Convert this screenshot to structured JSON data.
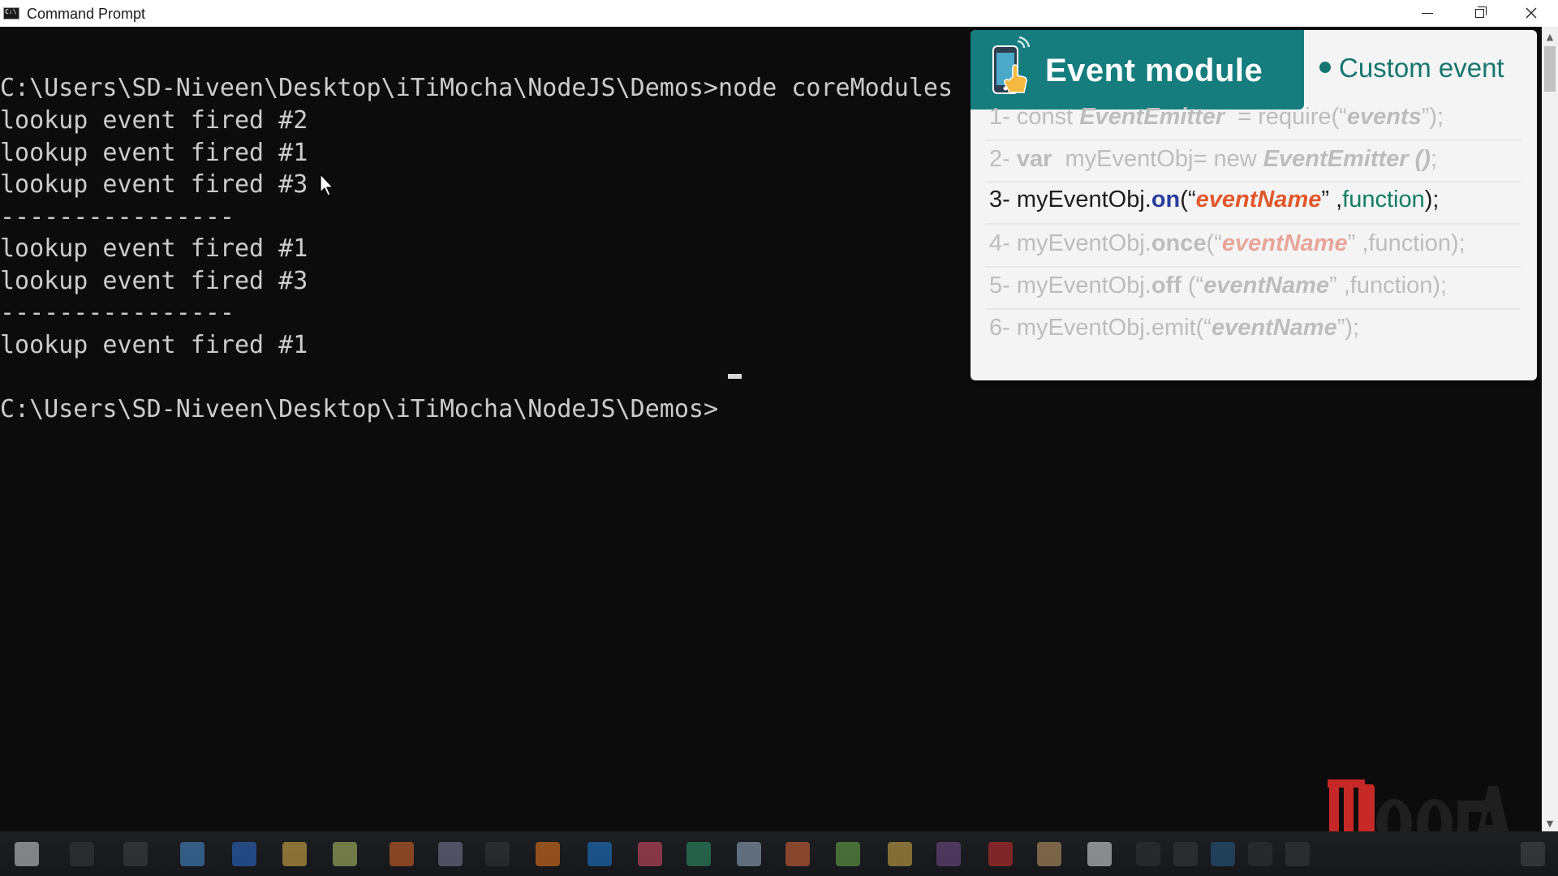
{
  "window": {
    "title": "Command Prompt",
    "controls": {
      "minimize": "minimize",
      "maximize": "restore",
      "close": "close"
    }
  },
  "console": {
    "lines": [
      "C:\\Users\\SD-Niveen\\Desktop\\iTiMocha\\NodeJS\\Demos>node coreModules",
      "lookup event fired #2",
      "lookup event fired #1",
      "lookup event fired #3",
      "----------------",
      "lookup event fired #1",
      "lookup event fired #3",
      "----------------",
      "lookup event fired #1",
      "",
      "C:\\Users\\SD-Niveen\\Desktop\\iTiMocha\\NodeJS\\Demos>"
    ]
  },
  "overlay": {
    "heading": "Event module",
    "subheading": "Custom event",
    "code_lines": {
      "l1": {
        "num": "1- ",
        "a": "const ",
        "cls": "EventEmitter",
        "b": "  = require(“",
        "str": "events",
        "c": "”);"
      },
      "l2": {
        "num": "2- ",
        "kw": "var",
        "a": "  myEventObj= new ",
        "cls": "EventEmitter",
        "call": " ()",
        "c": ";"
      },
      "l3": {
        "num": "3- ",
        "obj": "myEventObj.",
        "method": "on",
        "a": "(“",
        "name": "eventName",
        "b": "” ,",
        "fn": "function",
        "c": ");"
      },
      "l4": {
        "num": "4- ",
        "obj": "myEventObj.",
        "method": "once",
        "a": "(“",
        "name": "eventName",
        "b": "” ,function);"
      },
      "l5": {
        "num": "5- ",
        "obj": "myEventObj.",
        "method": "off",
        "a": " (“",
        "name": "eventName",
        "b": "” ,function);"
      },
      "l6": {
        "num": "6- ",
        "obj": "myEventObj.emit(“",
        "name": "eventName",
        "b": "”);"
      }
    }
  },
  "colors": {
    "console_bg": "#0c0c0c",
    "console_text": "#cccccc",
    "overlay_header": "#157d7e",
    "accent_orange": "#e2572a",
    "method_blue": "#2a3e9f",
    "function_green": "#0f7d62"
  },
  "icons": [
    "command-prompt-icon",
    "phone-touch-icon",
    "mouse-pointer-icon"
  ]
}
